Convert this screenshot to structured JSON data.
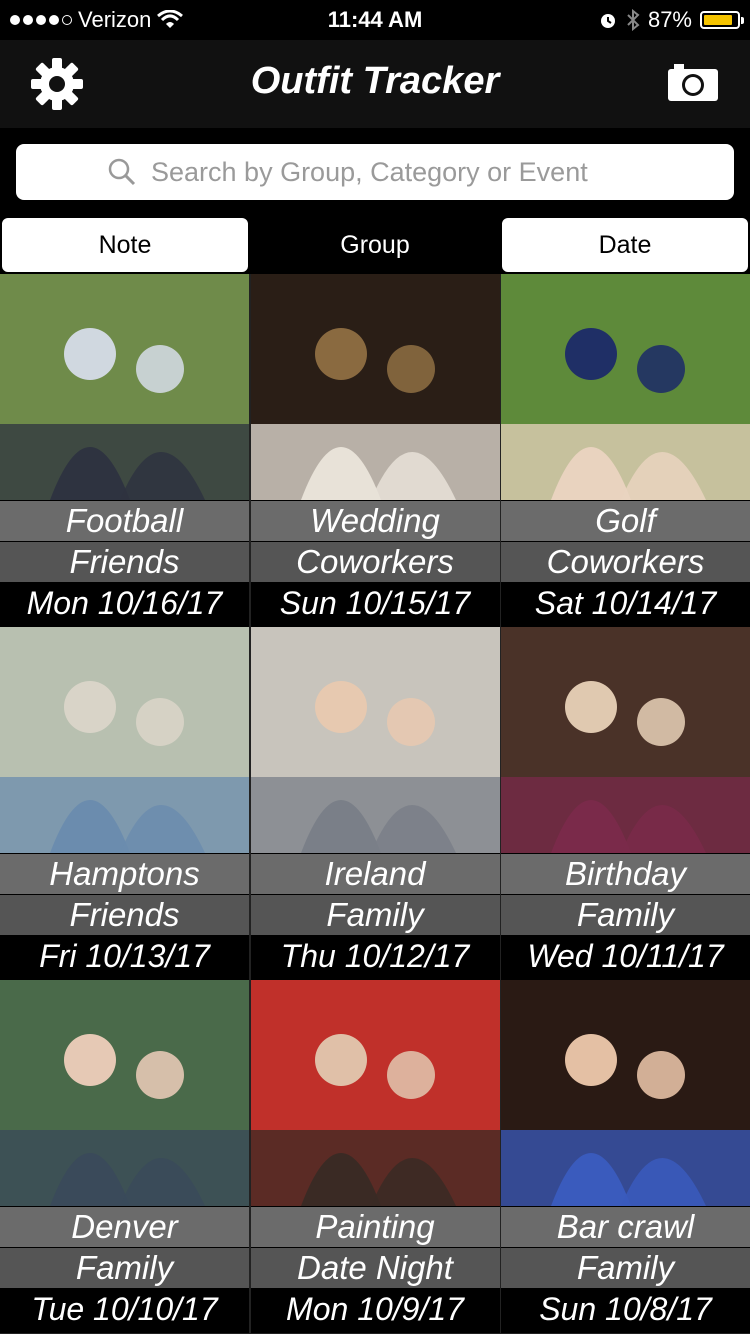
{
  "status": {
    "carrier": "Verizon",
    "time": "11:44 AM",
    "battery": "87%",
    "battery_level": 0.87
  },
  "header": {
    "title": "Outfit Tracker",
    "left_icon": "gear-icon",
    "right_icon": "camera-icon"
  },
  "search": {
    "placeholder": "Search by Group, Category or Event"
  },
  "segments": [
    {
      "label": "Note",
      "selected": false
    },
    {
      "label": "Group",
      "selected": true
    },
    {
      "label": "Date",
      "selected": false
    }
  ],
  "entries": [
    {
      "note": "Football",
      "group": "Friends",
      "date": "Mon  10/16/17",
      "palette": [
        "#6f8b4a",
        "#2e3340",
        "#d0d8e0"
      ]
    },
    {
      "note": "Wedding",
      "group": "Coworkers",
      "date": "Sun  10/15/17",
      "palette": [
        "#2a1e16",
        "#e8e2d8",
        "#8a6a40"
      ]
    },
    {
      "note": "Golf",
      "group": "Coworkers",
      "date": "Sat  10/14/17",
      "palette": [
        "#5e8a3a",
        "#e9d3bf",
        "#1f2f66"
      ]
    },
    {
      "note": "Hamptons",
      "group": "Friends",
      "date": "Fri  10/13/17",
      "palette": [
        "#b8c0b0",
        "#6b8cae",
        "#d9d4c8"
      ]
    },
    {
      "note": "Ireland",
      "group": "Family",
      "date": "Thu  10/12/17",
      "palette": [
        "#c8c4bc",
        "#7a7f88",
        "#e7c9b0"
      ]
    },
    {
      "note": "Birthday",
      "group": "Family",
      "date": "Wed  10/11/17",
      "palette": [
        "#4a3228",
        "#7a2a4a",
        "#e0c9b0"
      ]
    },
    {
      "note": "Denver",
      "group": "Family",
      "date": "Tue  10/10/17",
      "palette": [
        "#4a6a4a",
        "#3a4a5a",
        "#e6c9b5"
      ]
    },
    {
      "note": "Painting",
      "group": "Date Night",
      "date": "Mon  10/9/17",
      "palette": [
        "#c0302a",
        "#3a2a24",
        "#e0c0a8"
      ]
    },
    {
      "note": "Bar crawl",
      "group": "Family",
      "date": "Sun  10/8/17",
      "palette": [
        "#2a1a14",
        "#3a5bbd",
        "#e4c0a4"
      ]
    }
  ]
}
